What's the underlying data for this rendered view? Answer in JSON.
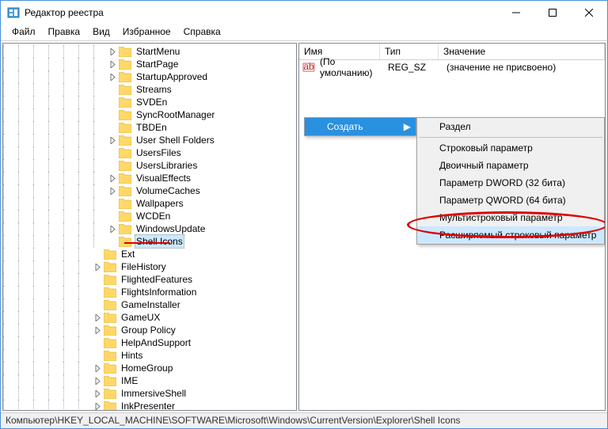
{
  "window": {
    "title": "Редактор реестра"
  },
  "menu": {
    "file": "Файл",
    "edit": "Правка",
    "view": "Вид",
    "favorites": "Избранное",
    "help": "Справка"
  },
  "tree": {
    "items": [
      {
        "indent": 7,
        "exp": "closed",
        "label": "StartMenu"
      },
      {
        "indent": 7,
        "exp": "closed",
        "label": "StartPage"
      },
      {
        "indent": 7,
        "exp": "closed",
        "label": "StartupApproved"
      },
      {
        "indent": 7,
        "exp": "none",
        "label": "Streams"
      },
      {
        "indent": 7,
        "exp": "none",
        "label": "SVDEn"
      },
      {
        "indent": 7,
        "exp": "none",
        "label": "SyncRootManager"
      },
      {
        "indent": 7,
        "exp": "none",
        "label": "TBDEn"
      },
      {
        "indent": 7,
        "exp": "closed",
        "label": "User Shell Folders"
      },
      {
        "indent": 7,
        "exp": "none",
        "label": "UsersFiles"
      },
      {
        "indent": 7,
        "exp": "none",
        "label": "UsersLibraries"
      },
      {
        "indent": 7,
        "exp": "closed",
        "label": "VisualEffects"
      },
      {
        "indent": 7,
        "exp": "closed",
        "label": "VolumeCaches"
      },
      {
        "indent": 7,
        "exp": "none",
        "label": "Wallpapers"
      },
      {
        "indent": 7,
        "exp": "none",
        "label": "WCDEn"
      },
      {
        "indent": 7,
        "exp": "closed",
        "label": "WindowsUpdate"
      },
      {
        "indent": 7,
        "exp": "none",
        "label": "Shell Icons",
        "selected": true
      },
      {
        "indent": 6,
        "exp": "none",
        "label": "Ext"
      },
      {
        "indent": 6,
        "exp": "closed",
        "label": "FileHistory"
      },
      {
        "indent": 6,
        "exp": "none",
        "label": "FlightedFeatures"
      },
      {
        "indent": 6,
        "exp": "none",
        "label": "FlightsInformation"
      },
      {
        "indent": 6,
        "exp": "none",
        "label": "GameInstaller"
      },
      {
        "indent": 6,
        "exp": "closed",
        "label": "GameUX"
      },
      {
        "indent": 6,
        "exp": "closed",
        "label": "Group Policy"
      },
      {
        "indent": 6,
        "exp": "none",
        "label": "HelpAndSupport"
      },
      {
        "indent": 6,
        "exp": "none",
        "label": "Hints"
      },
      {
        "indent": 6,
        "exp": "closed",
        "label": "HomeGroup"
      },
      {
        "indent": 6,
        "exp": "closed",
        "label": "IME"
      },
      {
        "indent": 6,
        "exp": "closed",
        "label": "ImmersiveShell"
      },
      {
        "indent": 6,
        "exp": "closed",
        "label": "InkPresenter"
      }
    ]
  },
  "list": {
    "headers": {
      "name": "Имя",
      "type": "Тип",
      "value": "Значение"
    },
    "rows": [
      {
        "name": "(По умолчанию)",
        "type": "REG_SZ",
        "value": "(значение не присвоено)"
      }
    ]
  },
  "contextMenu": {
    "parent": {
      "label": "Создать"
    },
    "items": [
      {
        "label": "Раздел"
      },
      {
        "sep": true
      },
      {
        "label": "Строковый параметр"
      },
      {
        "label": "Двоичный параметр"
      },
      {
        "label": "Параметр DWORD (32 бита)"
      },
      {
        "label": "Параметр QWORD (64 бита)"
      },
      {
        "label": "Мультистроковый параметр"
      },
      {
        "label": "Расширяемый строковый параметр",
        "highlight": true
      }
    ]
  },
  "status": {
    "path": "Компьютер\\HKEY_LOCAL_MACHINE\\SOFTWARE\\Microsoft\\Windows\\CurrentVersion\\Explorer\\Shell Icons"
  },
  "colors": {
    "highlight": "#2a90e0",
    "select": "#cce8ff",
    "red": "#d00000",
    "folder": "#ffd868"
  }
}
